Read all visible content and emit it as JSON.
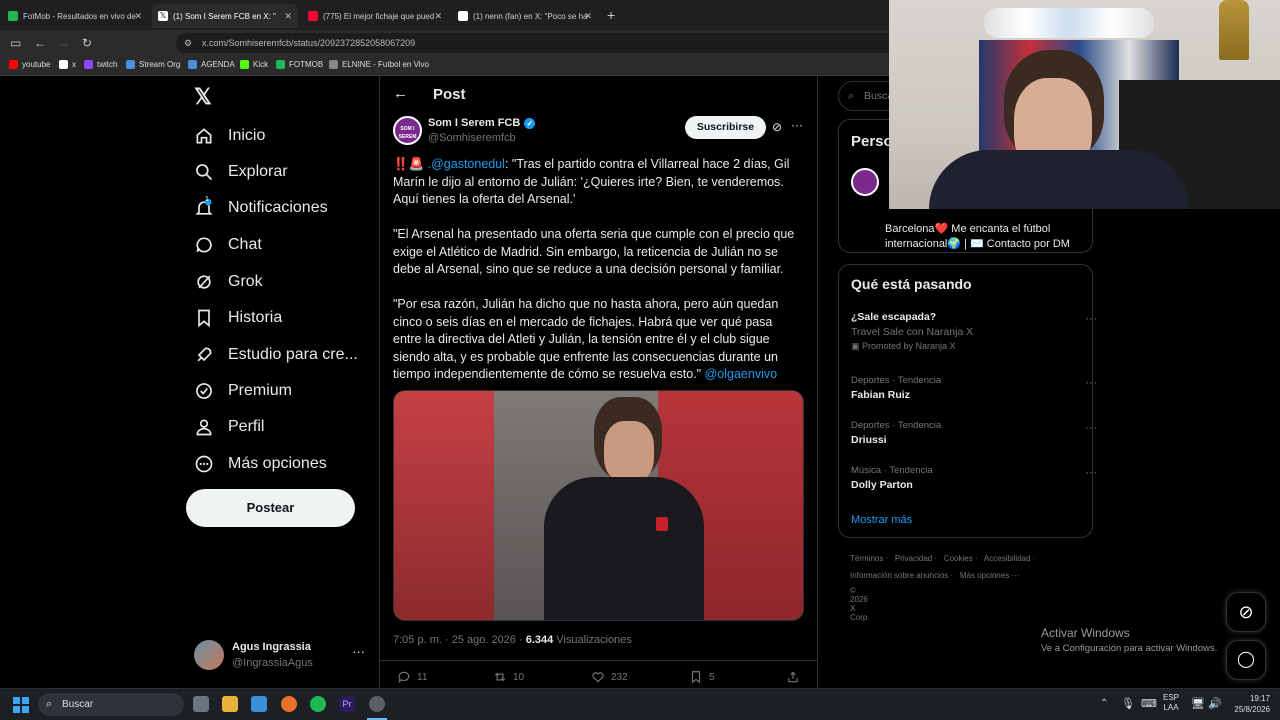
{
  "browser": {
    "tabs": [
      {
        "title": "FotMob - Resultados en vivo de",
        "color": "#1db954"
      },
      {
        "title": "(1) Som I Serem FCB en X: \"",
        "color": "#ffffff"
      },
      {
        "title": "(775) El mejor fichaje que pued",
        "color": "#ff0033"
      },
      {
        "title": "(1) nenn (fan) en X: \"Poco se ha",
        "color": "#ffffff"
      }
    ],
    "url": "x.com/Somhiseremfcb/status/2092372852058067209",
    "bookmarks": [
      {
        "label": "youtube",
        "color": "#ff0000"
      },
      {
        "label": "x",
        "color": "#ffffff"
      },
      {
        "label": "twitch",
        "color": "#9146ff"
      },
      {
        "label": "Stream Org",
        "color": "#4a90e2"
      },
      {
        "label": "AGENDA",
        "color": "#4a90e2"
      },
      {
        "label": "Kick",
        "color": "#53fc18"
      },
      {
        "label": "FOTMOB",
        "color": "#1db954"
      },
      {
        "label": "ELNINE - Futbol en Vivo",
        "color": "#888888"
      }
    ]
  },
  "sidebar": {
    "items": [
      {
        "label": "Inicio",
        "icon": "home-icon"
      },
      {
        "label": "Explorar",
        "icon": "search-icon"
      },
      {
        "label": "Notificaciones",
        "icon": "bell-icon",
        "badge": "1"
      },
      {
        "label": "Chat",
        "icon": "chat-icon"
      },
      {
        "label": "Grok",
        "icon": "grok-icon"
      },
      {
        "label": "Historia",
        "icon": "bookmark-icon"
      },
      {
        "label": "Estudio para cre...",
        "icon": "rocket-icon"
      },
      {
        "label": "Premium",
        "icon": "verified-icon"
      },
      {
        "label": "Perfil",
        "icon": "person-icon"
      },
      {
        "label": "Más opciones",
        "icon": "more-circle-icon"
      }
    ],
    "post_button": "Postear",
    "user": {
      "name": "Agus Ingrassia",
      "handle": "@IngrassiaAgus"
    }
  },
  "post": {
    "header": "Post",
    "author": {
      "name": "Som I Serem FCB",
      "handle": "@Somhiseremfcb",
      "avatar_text": "SOM I SEREM"
    },
    "subscribe": "Suscribirse",
    "p1_mention": ".@gastonedul",
    "p1_text": ": \"Tras el partido contra el Villarreal hace 2 días, Gil Marín le dijo al entorno de Julián: '¿Quieres irte? Bien, te venderemos. Aquí tienes la oferta del Arsenal.'",
    "p2": "\"El Arsenal ha presentado una oferta seria que cumple con el precio que exige el Atlético de Madrid. Sin embargo, la reticencia de Julián no se debe al Arsenal, sino que se reduce a una decisión personal y familiar.",
    "p3": "\"Por esa razón, Julián ha dicho que no hasta ahora, pero aún quedan cinco o seis días en el mercado de fichajes. Habrá que ver qué pasa entre la directiva del Atleti y Julián, la tensión entre él y el club sigue siendo alta, y es probable que enfrente las consecuencias durante un tiempo independientemente de cómo se resuelva esto.\"",
    "p3_mention": "@olgaenvivo",
    "meta_time": "7:05 p. m. · 25 ago. 2026 · ",
    "views": "6.344",
    "views_label": "Visualizaciones",
    "replies": "11",
    "reposts": "10",
    "likes": "232",
    "bookmarks": "5"
  },
  "right": {
    "search_placeholder": "Buscar",
    "persons_title": "Perso",
    "bio_line1": "Barcelona❤️ Me encanta el fútbol",
    "bio_line2": "internacional🌍 | ✉️ Contacto por DM",
    "trends_title": "Qué está pasando",
    "trends": [
      {
        "meta": "",
        "title": "¿Sale escapada?",
        "sub": "Travel Sale con Naranja X",
        "promo": "Promoted by Naranja X"
      },
      {
        "meta": "Deportes · Tendencia",
        "title": "Fabian Ruiz"
      },
      {
        "meta": "Deportes · Tendencia",
        "title": "Driussi"
      },
      {
        "meta": "Música · Tendencia",
        "title": "Dolly Parton"
      }
    ],
    "show_more": "Mostrar más",
    "footer1": [
      "Términos",
      "Privacidad",
      "Cookies",
      "Accesibilidad"
    ],
    "footer2": [
      "Información sobre anuncios",
      "Más opciones ···"
    ],
    "copyright": "© 2026 X Corp."
  },
  "activate": {
    "title": "Activar Windows",
    "sub": "Ve a Configuración para activar Windows."
  },
  "taskbar": {
    "search": "Buscar",
    "lang1": "ESP",
    "lang2": "LAA",
    "time": "19:17",
    "date": "25/8/2026"
  }
}
